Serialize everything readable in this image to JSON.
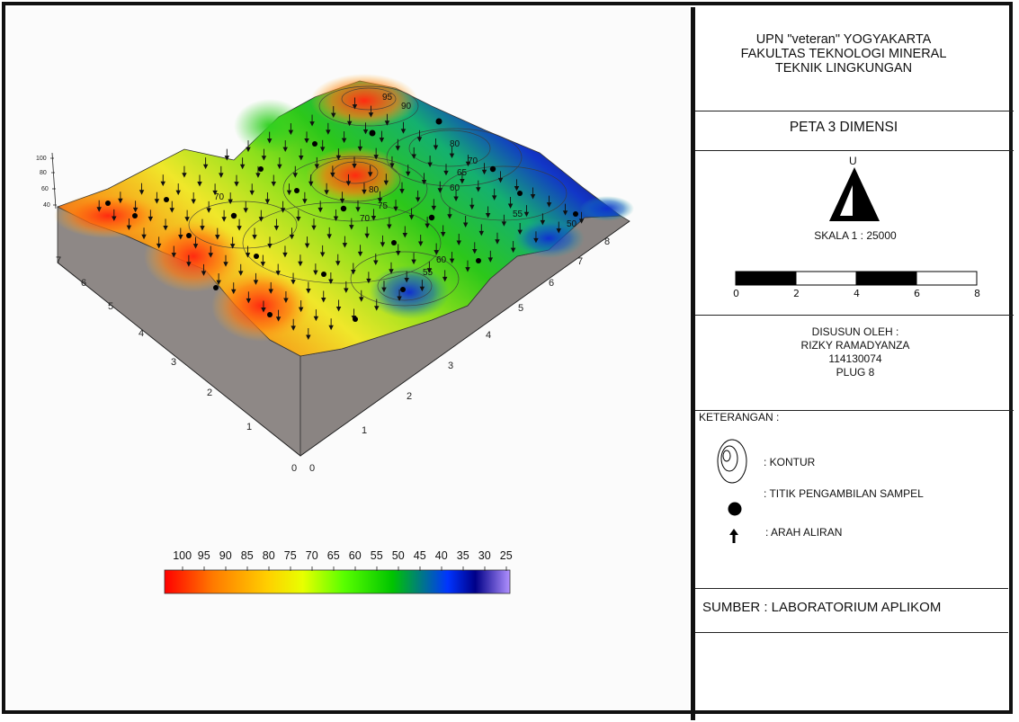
{
  "header": {
    "line1": "UPN \"veteran\" YOGYAKARTA",
    "line2": "FAKULTAS TEKNOLOGI MINERAL",
    "line3": "TEKNIK LINGKUNGAN"
  },
  "map_title": "PETA 3 DIMENSI",
  "north_label": "U",
  "scale_text": "SKALA 1 : 25000",
  "scale_bar_ticks": [
    "0",
    "2",
    "4",
    "6",
    "8"
  ],
  "author": {
    "heading": "DISUSUN OLEH :",
    "name": "RIZKY RAMADYANZA",
    "nim": "114130074",
    "plug": "PLUG 8"
  },
  "legend": {
    "heading": "KETERANGAN :",
    "items": [
      {
        "icon": "contour-icon",
        "label": ": KONTUR"
      },
      {
        "icon": "sample-point-icon",
        "label": ": TITIK PENGAMBILAN SAMPEL"
      },
      {
        "icon": "flow-arrow-icon",
        "label": ": ARAH ALIRAN"
      }
    ]
  },
  "source": "SUMBER : LABORATORIUM APLIKOM",
  "color_scale": {
    "labels": [
      "100",
      "95",
      "90",
      "85",
      "80",
      "75",
      "70",
      "65",
      "60",
      "55",
      "50",
      "45",
      "40",
      "35",
      "30",
      "25"
    ],
    "colors": [
      "#ff0000",
      "#ff7a00",
      "#ffd000",
      "#e8ff00",
      "#58ff00",
      "#00c400",
      "#0034ff",
      "#000088",
      "#b090ff"
    ]
  },
  "surface": {
    "contour_labels": [
      "95",
      "90",
      "80",
      "75",
      "70",
      "70",
      "65",
      "60",
      "60",
      "55",
      "55",
      "50",
      "70",
      "80"
    ],
    "axis_left_ticks": [
      "0",
      "1",
      "2",
      "3",
      "4",
      "5",
      "6",
      "7"
    ],
    "axis_right_ticks": [
      "0",
      "1",
      "2",
      "3",
      "4",
      "5",
      "6",
      "7",
      "8"
    ],
    "vertical_axis_ticks": [
      "100",
      "80",
      "60",
      "40"
    ]
  }
}
